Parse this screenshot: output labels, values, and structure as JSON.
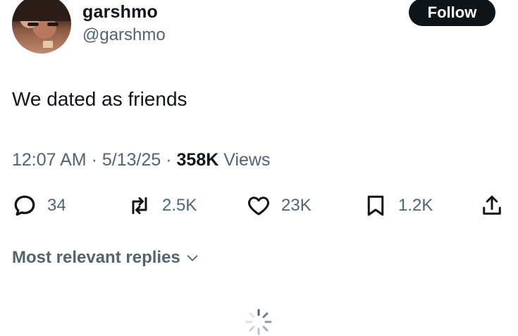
{
  "tweet": {
    "author_name": "garshmo",
    "author_handle": "@garshmo",
    "follow_label": "Follow",
    "text": "We dated as friends",
    "time": "12:07 AM",
    "date": "5/13/25",
    "separator": "·",
    "views_count": "358K",
    "views_label": "Views"
  },
  "actions": {
    "replies": "34",
    "reposts": "2.5K",
    "likes": "23K",
    "bookmarks": "1.2K"
  },
  "replies_sort": {
    "label": "Most relevant replies"
  },
  "icons": {
    "reply": "reply-icon",
    "repost": "repost-icon",
    "like": "heart-icon",
    "bookmark": "bookmark-icon",
    "share": "share-icon",
    "chevron": "chevron-down-icon",
    "loading": "loading-spinner-icon"
  },
  "colors": {
    "text_primary": "#0f1419",
    "text_secondary": "#536471",
    "follow_bg": "#0f1419",
    "follow_text": "#ffffff"
  }
}
